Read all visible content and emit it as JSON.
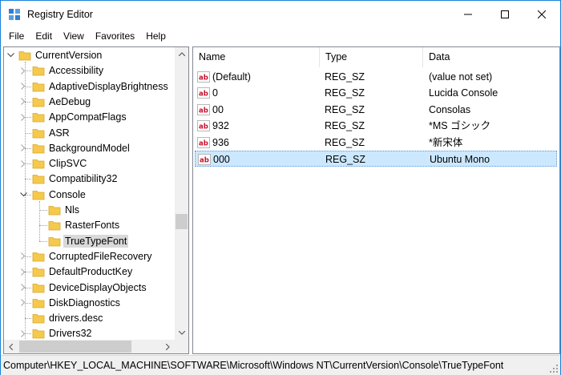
{
  "window": {
    "title": "Registry Editor",
    "icon": "registry-editor-icon",
    "controls": [
      "minimize-icon",
      "maximize-icon",
      "close-icon"
    ]
  },
  "menu": [
    "File",
    "Edit",
    "View",
    "Favorites",
    "Help"
  ],
  "tree": {
    "items": [
      {
        "label": "CurrentVersion",
        "expander": "expanded"
      },
      {
        "label": "Accessibility",
        "expander": "collapsed"
      },
      {
        "label": "AdaptiveDisplayBrightness",
        "expander": "collapsed"
      },
      {
        "label": "AeDebug",
        "expander": "collapsed"
      },
      {
        "label": "AppCompatFlags",
        "expander": "collapsed"
      },
      {
        "label": "ASR",
        "expander": "none"
      },
      {
        "label": "BackgroundModel",
        "expander": "collapsed"
      },
      {
        "label": "ClipSVC",
        "expander": "collapsed"
      },
      {
        "label": "Compatibility32",
        "expander": "none"
      },
      {
        "label": "Console",
        "expander": "expanded"
      },
      {
        "label": "Nls",
        "expander": "none"
      },
      {
        "label": "RasterFonts",
        "expander": "none"
      },
      {
        "label": "TrueTypeFont",
        "expander": "none",
        "selected": true
      },
      {
        "label": "CorruptedFileRecovery",
        "expander": "collapsed"
      },
      {
        "label": "DefaultProductKey",
        "expander": "collapsed"
      },
      {
        "label": "DeviceDisplayObjects",
        "expander": "collapsed"
      },
      {
        "label": "DiskDiagnostics",
        "expander": "collapsed"
      },
      {
        "label": "drivers.desc",
        "expander": "none"
      },
      {
        "label": "Drivers32",
        "expander": "collapsed"
      }
    ]
  },
  "values": {
    "columns": [
      "Name",
      "Type",
      "Data"
    ],
    "rows": [
      {
        "name": "(Default)",
        "type": "REG_SZ",
        "data": "(value not set)"
      },
      {
        "name": "0",
        "type": "REG_SZ",
        "data": "Lucida Console"
      },
      {
        "name": "00",
        "type": "REG_SZ",
        "data": "Consolas"
      },
      {
        "name": "932",
        "type": "REG_SZ",
        "data": "*MS ゴシック"
      },
      {
        "name": "936",
        "type": "REG_SZ",
        "data": "*新宋体"
      },
      {
        "name": "000",
        "type": "REG_SZ",
        "data": "Ubuntu Mono",
        "selected": true
      }
    ]
  },
  "status": {
    "path": "Computer\\HKEY_LOCAL_MACHINE\\SOFTWARE\\Microsoft\\Windows NT\\CurrentVersion\\Console\\TrueTypeFont"
  },
  "colors": {
    "folder": "#f5c94c",
    "selected_row": "#cce8ff",
    "accent": "#1883d7"
  }
}
